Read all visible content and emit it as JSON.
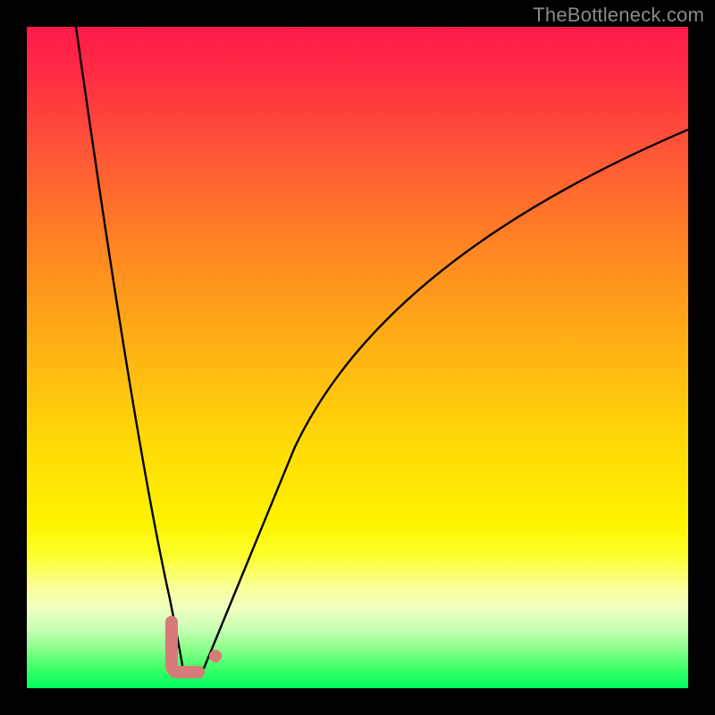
{
  "watermark": {
    "text": "TheBottleneck.com"
  },
  "chart_data": {
    "type": "line",
    "title": "",
    "xlabel": "",
    "ylabel": "",
    "xlim": [
      0,
      100
    ],
    "ylim": [
      0,
      100
    ],
    "background_gradient": {
      "direction": "vertical",
      "stops": [
        {
          "pos": 0,
          "color": "#ff1a4a"
        },
        {
          "pos": 8,
          "color": "#ff2f43"
        },
        {
          "pos": 20,
          "color": "#ff5a35"
        },
        {
          "pos": 34,
          "color": "#ff8722"
        },
        {
          "pos": 48,
          "color": "#ffb015"
        },
        {
          "pos": 62,
          "color": "#ffd708"
        },
        {
          "pos": 75,
          "color": "#fff400"
        },
        {
          "pos": 80,
          "color": "#fcff2d"
        },
        {
          "pos": 85,
          "color": "#faffa0"
        },
        {
          "pos": 88,
          "color": "#efffc0"
        },
        {
          "pos": 91,
          "color": "#c9ffb5"
        },
        {
          "pos": 94,
          "color": "#8cff8c"
        },
        {
          "pos": 97,
          "color": "#3fff6a"
        },
        {
          "pos": 100,
          "color": "#00ff5c"
        }
      ]
    },
    "series": [
      {
        "name": "left-branch",
        "color": "#000000",
        "x": [
          7.5,
          10,
          12,
          14,
          16,
          18,
          20,
          21,
          22,
          23
        ],
        "y": [
          100,
          80,
          64,
          49,
          35,
          22,
          10,
          6,
          3.5,
          2
        ]
      },
      {
        "name": "right-branch",
        "color": "#000000",
        "x": [
          26,
          28,
          30,
          34,
          40,
          48,
          58,
          70,
          84,
          100
        ],
        "y": [
          2,
          5,
          10,
          22,
          38,
          52,
          64,
          73,
          80,
          84
        ]
      }
    ],
    "marker": {
      "name": "l-shape-marker",
      "color": "#d77a7a",
      "x_range": [
        21.5,
        26
      ],
      "y_range": [
        2,
        8
      ]
    }
  }
}
